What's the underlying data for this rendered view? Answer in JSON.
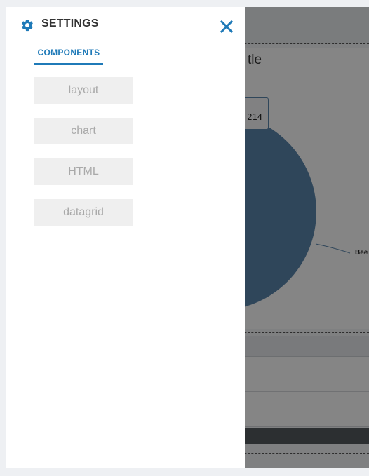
{
  "drawer": {
    "title": "SETTINGS",
    "tab_label": "COMPONENTS",
    "components": [
      "layout",
      "chart",
      "HTML",
      "datagrid"
    ],
    "accent_color": "#1f7ab8",
    "icons": {
      "settings": "gear-icon",
      "close": "close-icon"
    }
  },
  "background": {
    "chart_title_partial": "tle",
    "tooltip_value_partial": "214",
    "slice_label_partial": "Bee"
  }
}
